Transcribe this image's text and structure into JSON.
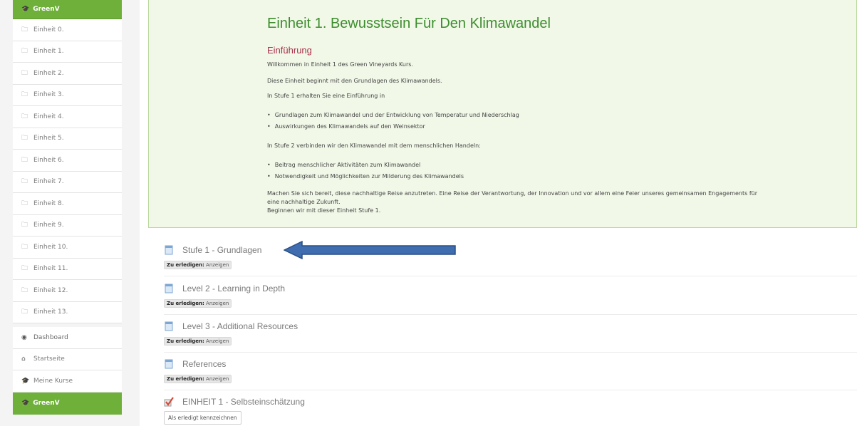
{
  "sidebar": {
    "course_head": "GreenV",
    "units": [
      "Einheit 0.",
      "Einheit 1.",
      "Einheit 2.",
      "Einheit 3.",
      "Einheit 4.",
      "Einheit 5.",
      "Einheit 6.",
      "Einheit 7.",
      "Einheit 8.",
      "Einheit 9.",
      "Einheit 10.",
      "Einheit 11.",
      "Einheit 12.",
      "Einheit 13."
    ],
    "nav": {
      "dashboard": "Dashboard",
      "home": "Startseite",
      "my_courses": "Meine Kurse"
    },
    "course_foot": "GreenV"
  },
  "summary": {
    "title": "Einheit 1. Bewusstsein Für Den Klimawandel",
    "subtitle": "Einführung",
    "p1": "Willkommen in Einheit 1 des Green Vineyards Kurs.",
    "p2": "Diese Einheit beginnt mit den Grundlagen des Klimawandels.",
    "p3": "In Stufe 1 erhalten Sie eine Einführung in",
    "list1": [
      "Grundlagen zum Klimawandel und der Entwicklung von Temperatur und Niederschlag",
      "Auswirkungen des Klimawandels auf den Weinsektor"
    ],
    "p4": "In Stufe 2 verbinden wir den Klimawandel mit dem menschlichen Handeln:",
    "list2": [
      "Beitrag menschlicher Aktivitäten zum Klimawandel",
      "Notwendigkeit und Möglichkeiten zur Milderung des Klimawandels"
    ],
    "p5a": "Machen Sie sich bereit, diese nachhaltige Reise anzutreten. Eine Reise der Verantwortung, der Innovation und vor allem eine Feier unseres gemeinsamen Engagements für",
    "p5b": "eine nachhaltige Zukunft.",
    "p6": "Beginnen wir mit dieser Einheit Stufe 1."
  },
  "activities": [
    {
      "title": "Stufe 1 - Grundlagen",
      "badge_label": "Zu erledigen:",
      "badge_value": "Anzeigen",
      "icon": "page-icon"
    },
    {
      "title": "Level 2 - Learning in Depth",
      "badge_label": "Zu erledigen:",
      "badge_value": "Anzeigen",
      "icon": "page-icon"
    },
    {
      "title": "Level 3 - Additional Resources",
      "badge_label": "Zu erledigen:",
      "badge_value": "Anzeigen",
      "icon": "page-icon"
    },
    {
      "title": "References",
      "badge_label": "Zu erledigen:",
      "badge_value": "Anzeigen",
      "icon": "page-icon"
    },
    {
      "title": "EINHEIT 1 - Selbsteinschätzung",
      "button": "Als erledigt kennzeichnen",
      "icon": "checklist-icon"
    }
  ],
  "colors": {
    "accent_green": "#6fb03b",
    "title_green": "#3d8d2f",
    "subtitle_red": "#a8324b",
    "arrow_blue": "#3f6db0"
  }
}
